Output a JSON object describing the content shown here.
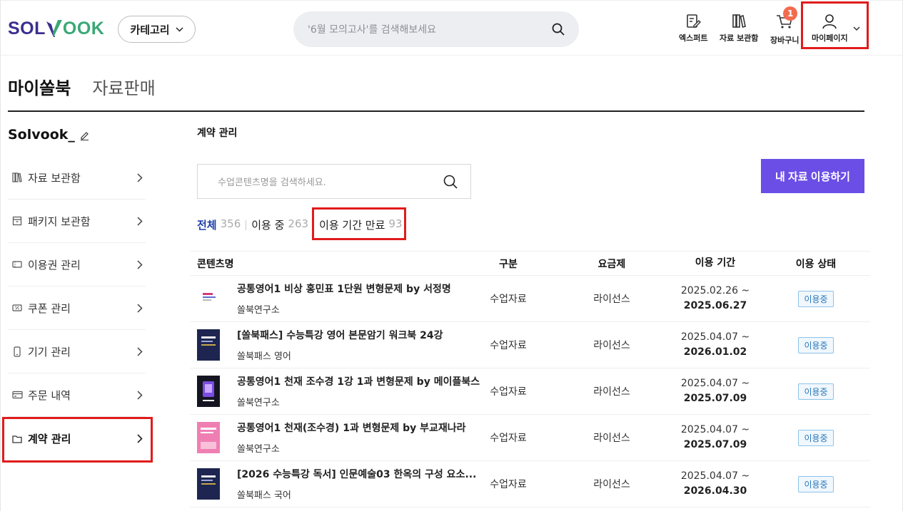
{
  "header": {
    "logo_part1": "SOL",
    "logo_part2": "OOK",
    "category_label": "카테고리",
    "search_placeholder": "'6월 모의고사'를 검색해보세요",
    "icons": [
      {
        "label": "엑스퍼트",
        "icon": "pencil-doc-icon"
      },
      {
        "label": "자료 보관함",
        "icon": "books-icon"
      },
      {
        "label": "장바구니",
        "icon": "cart-icon",
        "badge": "1"
      },
      {
        "label": "마이페이지",
        "icon": "user-icon"
      }
    ]
  },
  "tabs": [
    {
      "label": "마이쏠북",
      "active": true
    },
    {
      "label": "자료판매",
      "active": false
    }
  ],
  "sidebar": {
    "user_name": "Solvook_",
    "items": [
      {
        "label": "자료 보관함",
        "icon": "books-icon"
      },
      {
        "label": "패키지 보관함",
        "icon": "package-icon"
      },
      {
        "label": "이용권 관리",
        "icon": "ticket-icon"
      },
      {
        "label": "쿠폰 관리",
        "icon": "coupon-icon"
      },
      {
        "label": "기기 관리",
        "icon": "phone-icon"
      },
      {
        "label": "주문 내역",
        "icon": "card-icon"
      },
      {
        "label": "계약 관리",
        "icon": "folder-icon",
        "active": true
      }
    ]
  },
  "main": {
    "section_title": "계약 관리",
    "search_placeholder": "수업콘텐츠명을 검색하세요.",
    "primary_button": "내 자료 이용하기",
    "filters": [
      {
        "name": "전체",
        "count": "356",
        "active": true
      },
      {
        "name": "이용 중",
        "count": "263",
        "active": false
      },
      {
        "name": "이용 기간 만료",
        "count": "93",
        "active": false
      }
    ],
    "table": {
      "headers": [
        "콘텐츠명",
        "구분",
        "요금제",
        "이용 기간",
        "이용 상태"
      ],
      "rows": [
        {
          "title": "공통영어1 비상 홍민표 1단원 변형문제 by 서정명",
          "publisher": "쏠북연구소",
          "type": "수업자료",
          "plan": "라이선스",
          "start": "2025.02.26 ~",
          "end": "2025.06.27",
          "status": "이용중",
          "thumb": "white"
        },
        {
          "title": "[쏠북패스] 수능특강 영어 본문암기 워크북 24강",
          "publisher": "쏠북패스 영어",
          "type": "수업자료",
          "plan": "라이선스",
          "start": "2025.04.07 ~",
          "end": "2026.01.02",
          "status": "이용중",
          "thumb": "navy"
        },
        {
          "title": "공통영어1 천재 조수경 1강 1과 변형문제 by 메이플북스",
          "publisher": "쏠북연구소",
          "type": "수업자료",
          "plan": "라이선스",
          "start": "2025.04.07 ~",
          "end": "2025.07.09",
          "status": "이용중",
          "thumb": "dark"
        },
        {
          "title": "공통영어1 천재(조수경) 1과 변형문제 by 부교재나라",
          "publisher": "쏠북연구소",
          "type": "수업자료",
          "plan": "라이선스",
          "start": "2025.04.07 ~",
          "end": "2025.07.09",
          "status": "이용중",
          "thumb": "pink"
        },
        {
          "title": "[2026 수능특강 독서] 인문예술03 한옥의 구성 요소...",
          "publisher": "쏠북패스 국어",
          "type": "수업자료",
          "plan": "라이선스",
          "start": "2025.04.07 ~",
          "end": "2026.04.30",
          "status": "이용중",
          "thumb": "navy"
        }
      ]
    }
  },
  "colors": {
    "accent": "#6b4ee6",
    "active_filter": "#1d3fa8",
    "highlight": "#e11b1b",
    "badge": "#f26b4f"
  }
}
